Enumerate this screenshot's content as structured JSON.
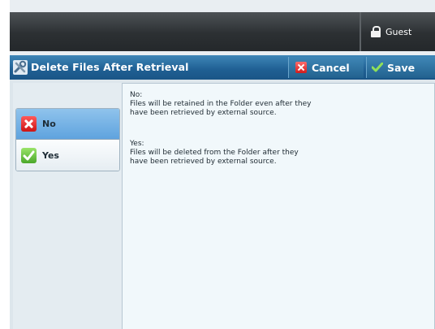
{
  "header": {
    "user_label": "Guest"
  },
  "titlebar": {
    "title": "Delete Files After Retrieval",
    "cancel_label": "Cancel",
    "save_label": "Save"
  },
  "options": [
    {
      "label": "No",
      "selected": true
    },
    {
      "label": "Yes",
      "selected": false
    }
  ],
  "description": {
    "no_heading": "No:",
    "no_line1": "Files will be retained in the Folder even after they",
    "no_line2": "have been retrieved by external source.",
    "yes_heading": "Yes:",
    "yes_line1": "Files will be deleted from the Folder after they",
    "yes_line2": "have been retrieved by external source."
  },
  "icons": {
    "user": "lock-icon",
    "title": "tools-icon",
    "cancel": "close-icon",
    "save": "checkmark-icon",
    "option_no": "close-icon",
    "option_yes": "checkmark-icon"
  },
  "colors": {
    "accent": "#1f5f93",
    "selected_option": "#6aaae0",
    "cancel_red": "#d11c1c",
    "save_green": "#4aa72a"
  }
}
